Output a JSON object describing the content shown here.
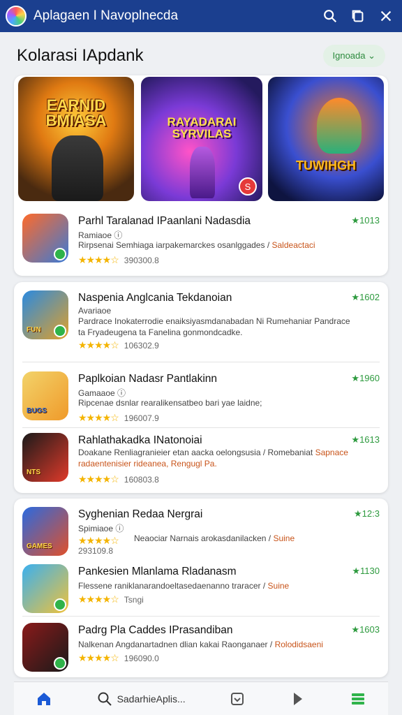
{
  "app": {
    "title": "Aplagaen I Navoplnecda"
  },
  "section": {
    "title": "Kolarasi IApdank",
    "button_label": "Ignoada ⌄"
  },
  "featured": [
    {
      "title": "EARNID BMIASA"
    },
    {
      "title": "RAYADARAI SYRVILAS"
    },
    {
      "title": "TUWIHGH"
    }
  ],
  "apps": [
    {
      "name": "Parhl Taralanad IPaanlani Nadasdia",
      "category": "Ramiaoe ⓘ",
      "desc_text": "Rirpsenai Semhiaga iarpakemarckes osanlggades /",
      "desc_tag": "Saldeactaci",
      "stars": "★★★★☆",
      "meta": "390300.8",
      "rating": "★1013"
    },
    {
      "name": "Naspenia Anglcania Tekdanoian",
      "category": "Avariaoe",
      "desc_text": "Pardrace Inokaterrodie enaiksiyasmdanabadan Ni Rumehaniar",
      "desc_tag": "Pandrace ta Fryadeugena ta Fanelina gonmondcadke.",
      "stars": "★★★★☆",
      "meta": "106302.9",
      "rating": "★1602"
    },
    {
      "name": "Paplkoian Nadasr Pantlakinn",
      "category": "Gamaaoe ⓘ",
      "desc_text": "Ripcenae dsnlar rearalikensatbeo bari yae laidne;",
      "desc_tag": "",
      "stars": "★★★★☆",
      "meta": "196007.9",
      "rating": "★1960"
    },
    {
      "name": "Rahlathakadka INatonoiai",
      "category": "",
      "desc_text": "Doakane Renliagranieier etan aacka oelongsusia / Romebaniat",
      "desc_tag": "Sapnace radaentenisier rideanea, Rengugl Pa.",
      "stars": "★★★★☆",
      "meta": "160803.8",
      "rating": "★1613"
    },
    {
      "name": "Syghenian Redaa Nergrai",
      "category": "Spimiaoe ⓘ",
      "desc_text": "Neaociar Narnais arokasdanilacken /",
      "desc_tag": "Suine",
      "stars": "★★★★☆",
      "meta": "293109.8",
      "rating": "★12:3"
    },
    {
      "name": "Pankesien Mlanlama Rladanasm",
      "category": "",
      "desc_text": "Flessene raniklanarandoeltasedaenanno traracer /",
      "desc_tag": "Suine",
      "stars": "★★★★☆",
      "meta": "Tsngi",
      "rating": "★1130"
    },
    {
      "name": "Padrg Pla Caddes IPrasandiban",
      "category": "",
      "desc_text": "Nalkenan Angdanartadnen dlian kakai Raonganaer /",
      "desc_tag": "Rolodidsaeni",
      "stars": "★★★★☆",
      "meta": "196090.0",
      "rating": "★1603"
    }
  ],
  "nav": {
    "search_label": "SadarhieAplis..."
  },
  "colors": {
    "topbar": "#1b3f8f",
    "accent_green": "#2d9a3e",
    "star": "#f4b400"
  }
}
